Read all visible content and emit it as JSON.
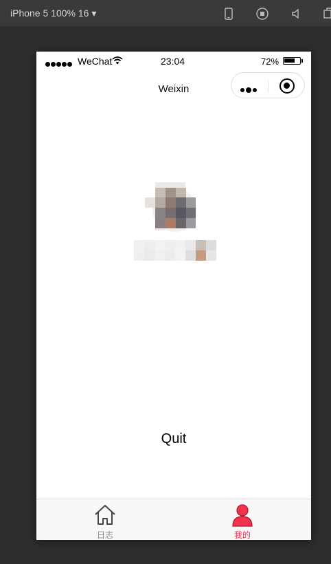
{
  "toolbar": {
    "device_label": "iPhone 5 100% 16 ▾",
    "icons": [
      "phone-icon",
      "record-icon",
      "volume-icon",
      "copy-icon"
    ]
  },
  "status_bar": {
    "carrier": "WeChat",
    "time": "23:04",
    "battery_percent": "72%",
    "battery_level": 0.72
  },
  "nav": {
    "title": "Weixin"
  },
  "profile": {
    "avatar": "user-avatar",
    "nickname": "user-nickname"
  },
  "actions": {
    "quit_label": "Quit"
  },
  "tabbar": {
    "items": [
      {
        "label": "日志",
        "icon": "home-icon",
        "active": false
      },
      {
        "label": "我的",
        "icon": "user-icon",
        "active": true
      }
    ],
    "active_color": "#f0344d",
    "inactive_color": "#888888"
  }
}
